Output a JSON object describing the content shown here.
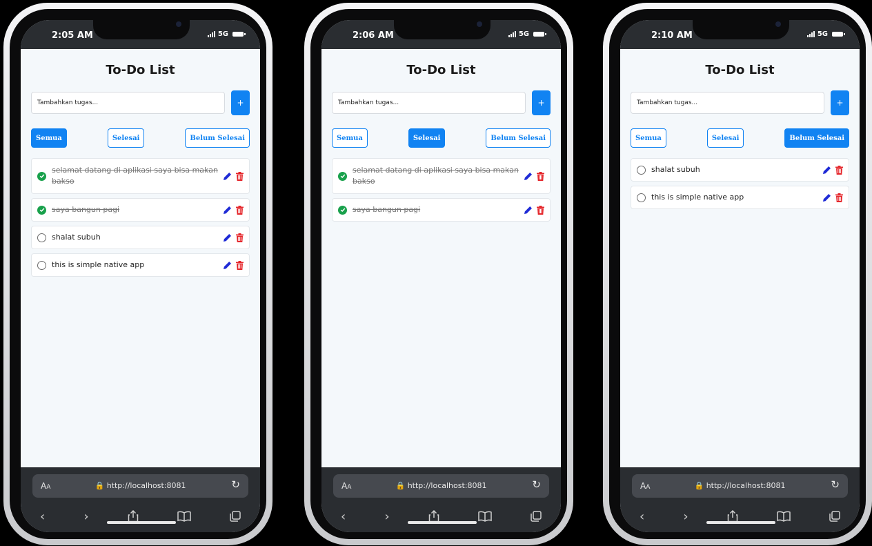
{
  "app": {
    "title": "To-Do List",
    "input_placeholder": "Tambahkan tugas...",
    "add_label": "+"
  },
  "filters": [
    "Semua",
    "Selesai",
    "Belum Selesai"
  ],
  "browser": {
    "aa_big": "A",
    "aa_small": "A",
    "url": "http://localhost:8081",
    "reload": "↻"
  },
  "colors": {
    "accent": "#1183f2",
    "done": "#19a14c",
    "edit": "#1f2bd6",
    "delete": "#e5262b"
  },
  "network": "5G",
  "screens": [
    {
      "time": "2:05 AM",
      "active_filter": "Semua",
      "tasks": [
        {
          "text": "selamat datang di aplikasi saya bisa makan bakso",
          "done": true
        },
        {
          "text": "saya bangun pagi",
          "done": true
        },
        {
          "text": "shalat subuh",
          "done": false
        },
        {
          "text": "this is simple native app",
          "done": false
        }
      ]
    },
    {
      "time": "2:06 AM",
      "active_filter": "Selesai",
      "tasks": [
        {
          "text": "selamat datang di aplikasi saya bisa makan bakso",
          "done": true
        },
        {
          "text": "saya bangun pagi",
          "done": true
        }
      ]
    },
    {
      "time": "2:10 AM",
      "active_filter": "Belum Selesai",
      "tasks": [
        {
          "text": "shalat subuh",
          "done": false
        },
        {
          "text": "this is simple native app",
          "done": false
        }
      ]
    }
  ]
}
